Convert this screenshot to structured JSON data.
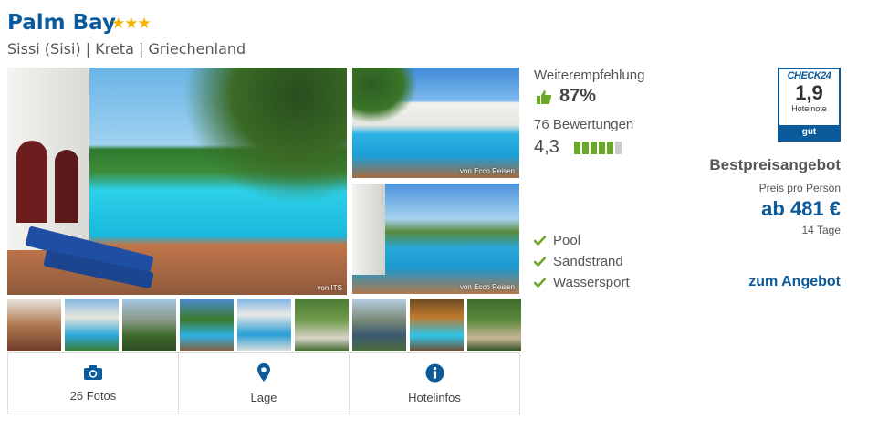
{
  "hotel": {
    "name": "Palm Bay",
    "stars": "★★★",
    "location": "Sissi (Sisi) | Kreta | Griechenland"
  },
  "photos": {
    "main_credit": "von ITS",
    "side1_credit": "von Ecco Reisen",
    "side2_credit": "von Ecco Reisen"
  },
  "tabs": [
    {
      "label": "26 Fotos",
      "icon": "camera-icon"
    },
    {
      "label": "Lage",
      "icon": "location-pin-icon"
    },
    {
      "label": "Hotelinfos",
      "icon": "info-icon"
    }
  ],
  "recommendation": {
    "label": "Weiterempfehlung",
    "value": "87%",
    "icon": "thumbs-up-icon"
  },
  "reviews": {
    "count_label": "76 Bewertungen",
    "score": "4,3",
    "bars_total": 6,
    "bars_filled": 5
  },
  "features": [
    {
      "label": "Pool",
      "icon": "check-icon"
    },
    {
      "label": "Sandstrand",
      "icon": "check-icon"
    },
    {
      "label": "Wassersport",
      "icon": "check-icon"
    }
  ],
  "badge": {
    "brand": "CHECK24",
    "score": "1,9",
    "label": "Hotelnote",
    "verdict": "gut"
  },
  "offer": {
    "title": "Bestpreisangebot",
    "per_person": "Preis pro Person",
    "price": "ab 481 €",
    "duration": "14 Tage",
    "link": "zum Angebot"
  },
  "colors": {
    "brand_blue": "#0a5a9c",
    "star_gold": "#f5b400",
    "green": "#6aa82a"
  }
}
